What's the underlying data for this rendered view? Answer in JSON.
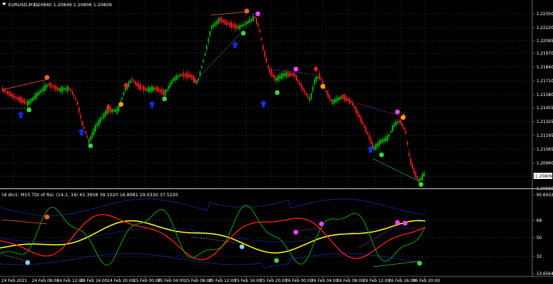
{
  "main_header": {
    "symbol": "EURUSD,M15",
    "ohlc": "1.20840 1.20849 1.20806 1.20809"
  },
  "main_price_ticks": [
    "1.22350",
    "1.22220",
    "1.22095",
    "1.21970",
    "1.21840",
    "1.21710",
    "1.21580",
    "1.21455",
    "1.21325",
    "1.21195",
    "1.21065",
    "1.20940",
    "1.20680"
  ],
  "current_price": "1.20809",
  "sub_header": "td div1: M15 TDI of Rsi: (14,1, 14) 61.3958 39.1020 16.8081 29.0330 37.5220",
  "sub_ticks": [
    "95.6432",
    "68",
    "50",
    "32",
    "13.6564"
  ],
  "time_labels": [
    "24 Feb 2021",
    "24 Feb 08:00",
    "24 Feb 12:00",
    "24 Feb 16:00",
    "24 Feb 20:00",
    "25 Feb 00:00",
    "25 Feb 04:00",
    "25 Feb 08:00",
    "25 Feb 12:00",
    "25 Feb 16:00",
    "25 Feb 20:00",
    "26 Feb 00:00",
    "26 Feb 04:00",
    "26 Feb 08:00",
    "26 Feb 12:00",
    "26 Feb 16:00",
    "26 Feb 20:00"
  ],
  "colors": {
    "background": "#000000",
    "bull_candle": "#00c800",
    "bear_candle": "#ff2020",
    "grid": "#2a4a7a",
    "tdi_green": "#00a000",
    "tdi_red": "#ff1a1a",
    "tdi_yellow": "#ffff00",
    "tdi_band": "#1a2aa0",
    "arrow_up": "#0030ff",
    "dot_green": "#40d040",
    "dot_pink": "#ff40ff",
    "dot_orange": "#ffa000"
  },
  "icons": [
    "triangle-down-icon",
    "arrow-up-icon",
    "arrow-down-icon",
    "signal-dot-icon"
  ]
}
